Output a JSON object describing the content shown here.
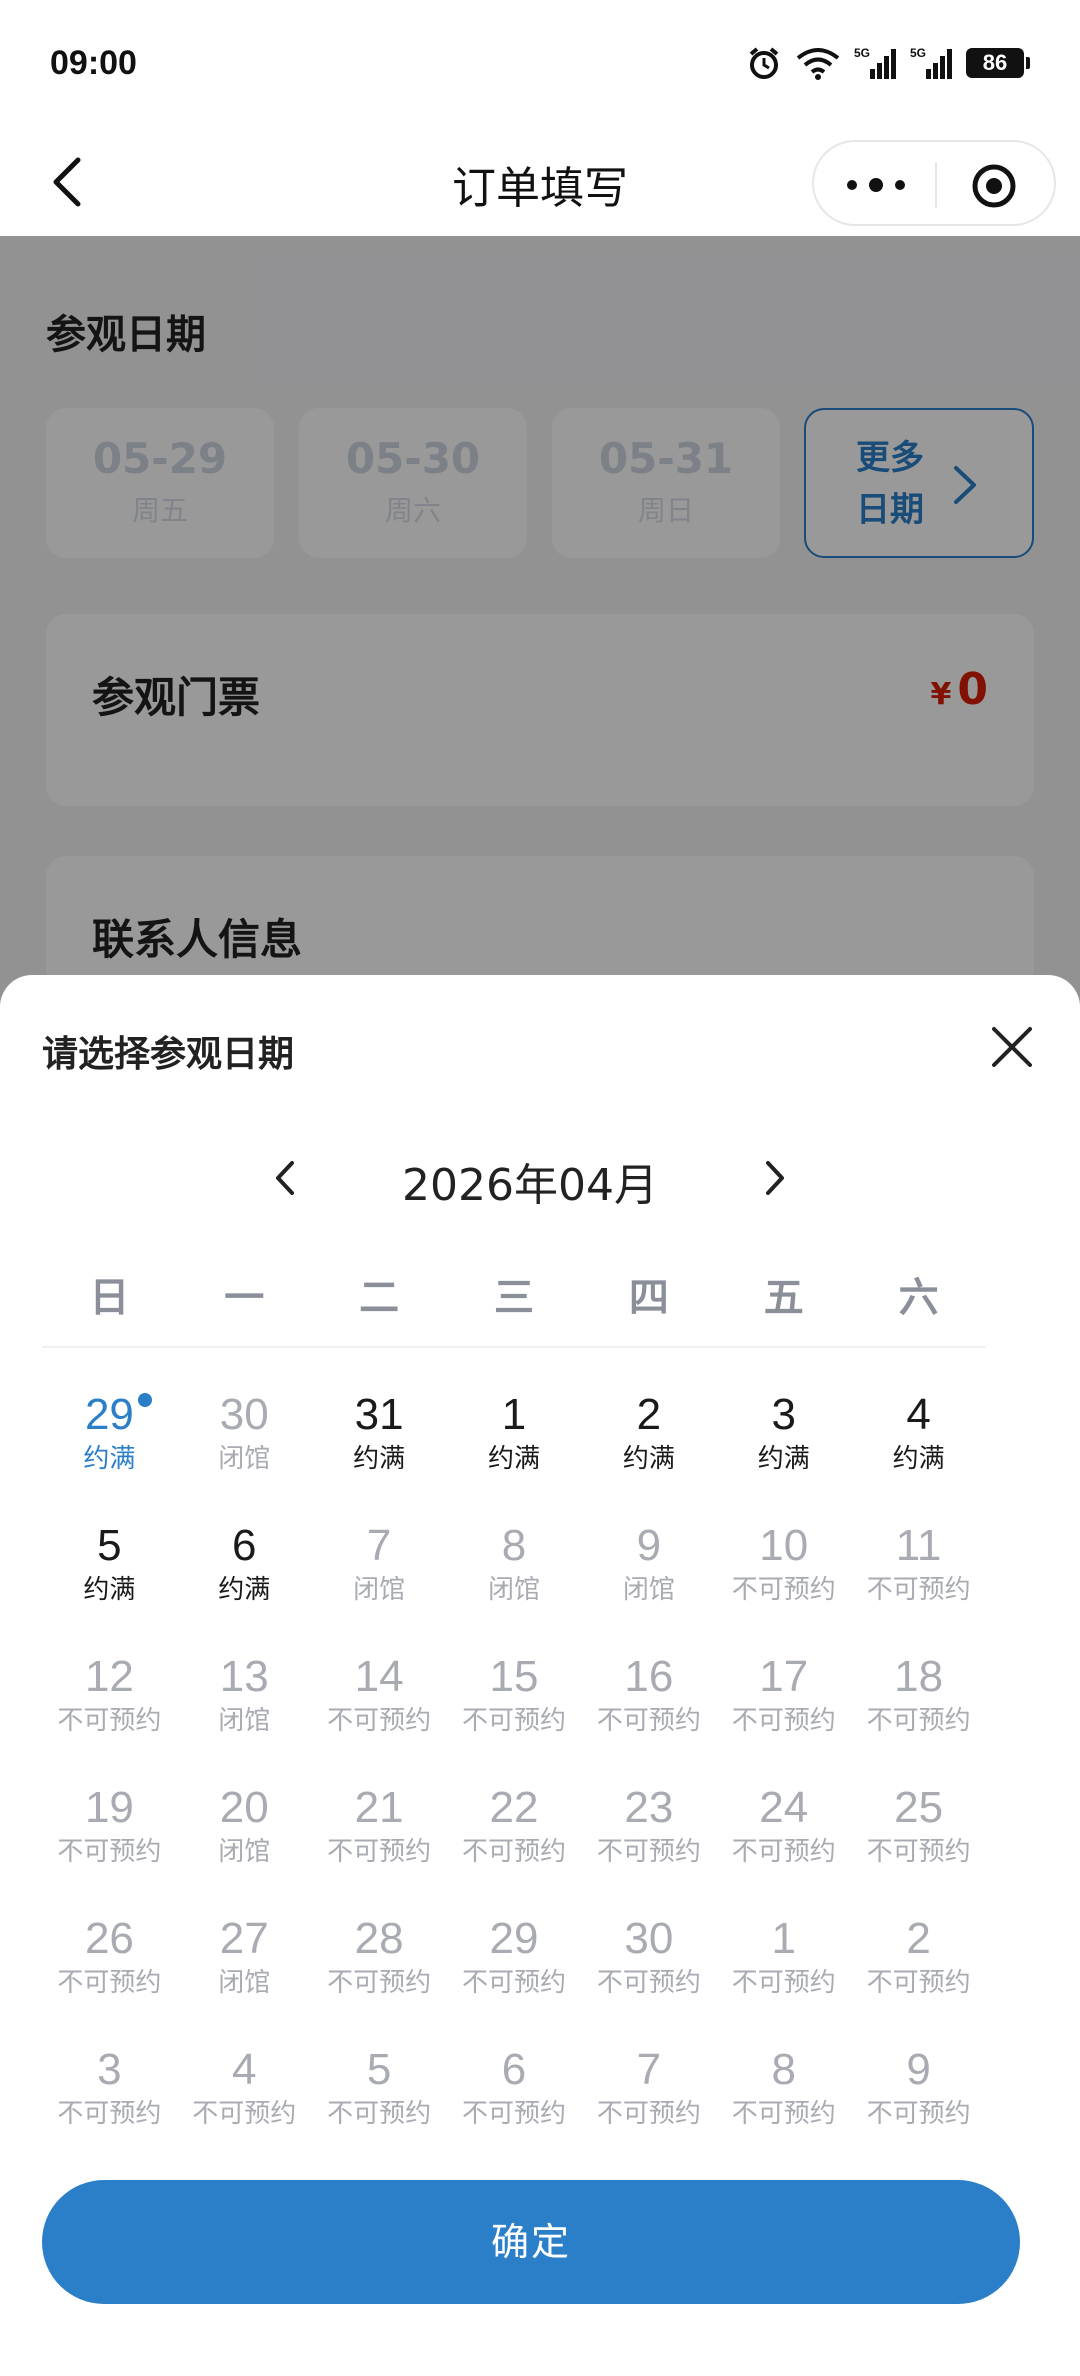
{
  "status_bar": {
    "time": "09:00",
    "battery": "86",
    "icons": [
      "alarm-icon",
      "wifi-icon",
      "5g-signal-icon",
      "5g-signal-icon",
      "battery-icon"
    ]
  },
  "nav": {
    "title": "订单填写",
    "back_icon": "chevron-left-icon",
    "more_icon": "more-dots-icon",
    "close_icon": "target-icon"
  },
  "page": {
    "visit_date_title": "参观日期",
    "date_chips": [
      {
        "date": "05-29",
        "sub": "周五"
      },
      {
        "date": "05-30",
        "sub": "周六"
      },
      {
        "date": "05-31",
        "sub": "周日"
      }
    ],
    "more_dates": "更多日期",
    "ticket_title": "参观门票",
    "price_symbol": "¥",
    "price": "0",
    "contact_title": "联系人信息"
  },
  "sheet": {
    "title": "请选择参观日期",
    "month": "2026年04月",
    "weekdays": [
      "日",
      "一",
      "二",
      "三",
      "四",
      "五",
      "六"
    ],
    "days": [
      {
        "n": "29",
        "s": "约满",
        "state": "selected"
      },
      {
        "n": "30",
        "s": "闭馆",
        "state": "disabled"
      },
      {
        "n": "31",
        "s": "约满",
        "state": "available"
      },
      {
        "n": "1",
        "s": "约满",
        "state": "available"
      },
      {
        "n": "2",
        "s": "约满",
        "state": "available"
      },
      {
        "n": "3",
        "s": "约满",
        "state": "available"
      },
      {
        "n": "4",
        "s": "约满",
        "state": "available"
      },
      {
        "n": "5",
        "s": "约满",
        "state": "available"
      },
      {
        "n": "6",
        "s": "约满",
        "state": "available"
      },
      {
        "n": "7",
        "s": "闭馆",
        "state": "disabled"
      },
      {
        "n": "8",
        "s": "闭馆",
        "state": "disabled"
      },
      {
        "n": "9",
        "s": "闭馆",
        "state": "disabled"
      },
      {
        "n": "10",
        "s": "不可预约",
        "state": "disabled"
      },
      {
        "n": "11",
        "s": "不可预约",
        "state": "disabled"
      },
      {
        "n": "12",
        "s": "不可预约",
        "state": "disabled"
      },
      {
        "n": "13",
        "s": "闭馆",
        "state": "disabled"
      },
      {
        "n": "14",
        "s": "不可预约",
        "state": "disabled"
      },
      {
        "n": "15",
        "s": "不可预约",
        "state": "disabled"
      },
      {
        "n": "16",
        "s": "不可预约",
        "state": "disabled"
      },
      {
        "n": "17",
        "s": "不可预约",
        "state": "disabled"
      },
      {
        "n": "18",
        "s": "不可预约",
        "state": "disabled"
      },
      {
        "n": "19",
        "s": "不可预约",
        "state": "disabled"
      },
      {
        "n": "20",
        "s": "闭馆",
        "state": "disabled"
      },
      {
        "n": "21",
        "s": "不可预约",
        "state": "disabled"
      },
      {
        "n": "22",
        "s": "不可预约",
        "state": "disabled"
      },
      {
        "n": "23",
        "s": "不可预约",
        "state": "disabled"
      },
      {
        "n": "24",
        "s": "不可预约",
        "state": "disabled"
      },
      {
        "n": "25",
        "s": "不可预约",
        "state": "disabled"
      },
      {
        "n": "26",
        "s": "不可预约",
        "state": "disabled"
      },
      {
        "n": "27",
        "s": "闭馆",
        "state": "disabled"
      },
      {
        "n": "28",
        "s": "不可预约",
        "state": "disabled"
      },
      {
        "n": "29",
        "s": "不可预约",
        "state": "disabled"
      },
      {
        "n": "30",
        "s": "不可预约",
        "state": "disabled"
      },
      {
        "n": "1",
        "s": "不可预约",
        "state": "disabled"
      },
      {
        "n": "2",
        "s": "不可预约",
        "state": "disabled"
      },
      {
        "n": "3",
        "s": "不可预约",
        "state": "disabled"
      },
      {
        "n": "4",
        "s": "不可预约",
        "state": "disabled"
      },
      {
        "n": "5",
        "s": "不可预约",
        "state": "disabled"
      },
      {
        "n": "6",
        "s": "不可预约",
        "state": "disabled"
      },
      {
        "n": "7",
        "s": "不可预约",
        "state": "disabled"
      },
      {
        "n": "8",
        "s": "不可预约",
        "state": "disabled"
      },
      {
        "n": "9",
        "s": "不可预约",
        "state": "disabled"
      }
    ],
    "today_marker_index": 0,
    "confirm_label": "确定"
  },
  "colors": {
    "accent": "#2b7fc8",
    "price": "#d81e06",
    "disabled_text": "#a8abb2"
  }
}
